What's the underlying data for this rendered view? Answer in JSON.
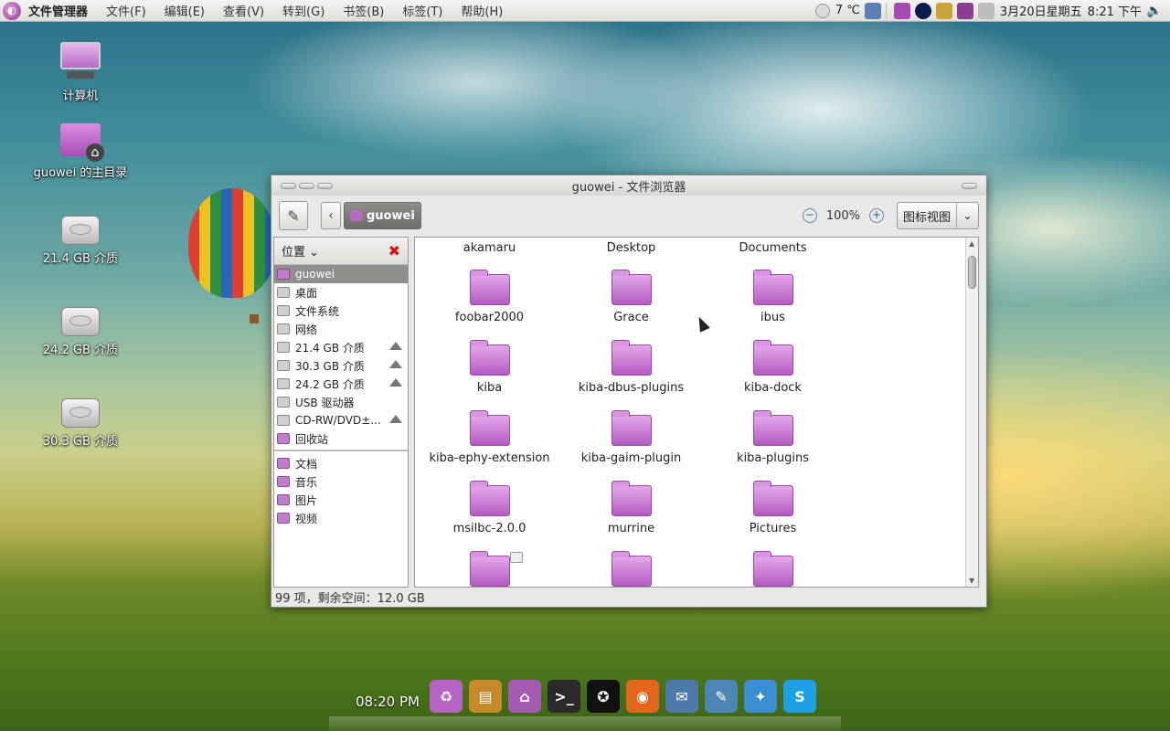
{
  "top_panel": {
    "app_name": "文件管理器",
    "menu": [
      "文件(F)",
      "编辑(E)",
      "查看(V)",
      "转到(G)",
      "书签(B)",
      "标签(T)",
      "帮助(H)"
    ],
    "weather": "7 ℃",
    "datetime": "3月20日星期五",
    "time": "8:21 下午"
  },
  "desktop_icons": [
    {
      "label": "计算机",
      "icon": "computer-icon"
    },
    {
      "label": "guowei 的主目录",
      "icon": "home-folder-icon"
    },
    {
      "label": "21.4 GB 介质",
      "icon": "drive-icon"
    },
    {
      "label": "24.2 GB 介质",
      "icon": "drive-icon"
    },
    {
      "label": "30.3 GB 介质",
      "icon": "drive-icon"
    }
  ],
  "window": {
    "title": "guowei - 文件浏览器",
    "path_button": "guowei",
    "zoom": "100%",
    "view_mode": "图标视图",
    "sidebar_title": "位置",
    "places": [
      {
        "label": "guowei",
        "icon": "home-icon",
        "eject": false,
        "selected": true
      },
      {
        "label": "桌面",
        "icon": "desktop-icon",
        "eject": false
      },
      {
        "label": "文件系统",
        "icon": "filesystem-icon",
        "eject": false
      },
      {
        "label": "网络",
        "icon": "network-icon",
        "eject": false
      },
      {
        "label": "21.4 GB 介质",
        "icon": "drive-icon",
        "eject": true
      },
      {
        "label": "30.3 GB 介质",
        "icon": "drive-icon",
        "eject": true
      },
      {
        "label": "24.2 GB 介质",
        "icon": "drive-icon",
        "eject": true
      },
      {
        "label": "USB 驱动器",
        "icon": "usb-icon",
        "eject": false
      },
      {
        "label": "CD-RW/DVD±...",
        "icon": "optical-drive-icon",
        "eject": true
      },
      {
        "label": "回收站",
        "icon": "trash-icon",
        "eject": false
      }
    ],
    "bookmarks": [
      {
        "label": "文档",
        "icon": "folder-icon"
      },
      {
        "label": "音乐",
        "icon": "folder-icon"
      },
      {
        "label": "图片",
        "icon": "folder-icon"
      },
      {
        "label": "视频",
        "icon": "folder-icon"
      }
    ],
    "files_top_row": [
      "akamaru",
      "Desktop",
      "Documents"
    ],
    "files": [
      "foobar2000",
      "Grace",
      "ibus",
      "kiba",
      "kiba-dbus-plugins",
      "kiba-dock",
      "kiba-ephy-extension",
      "kiba-gaim-plugin",
      "kiba-plugins",
      "msilbc-2.0.0",
      "murrine",
      "Pictures"
    ],
    "status": "99 项，剩余空间：12.0 GB"
  },
  "dock": {
    "clock": "08:20 PM",
    "items": [
      "trash-icon",
      "archive-icon",
      "home-folder-icon",
      "terminal-icon",
      "qq-icon",
      "firefox-icon",
      "thunderbird-icon",
      "text-editor-icon",
      "pidgin-icon",
      "skype-icon"
    ]
  }
}
